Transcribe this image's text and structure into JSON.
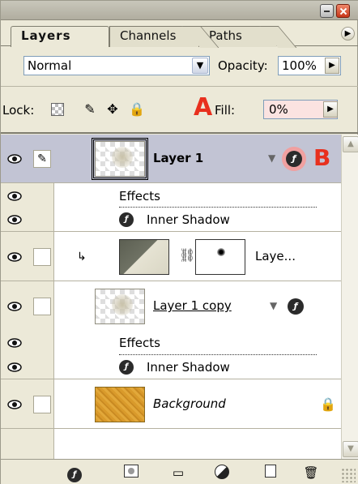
{
  "tabs": [
    {
      "label": "Layers",
      "active": true
    },
    {
      "label": "Channels",
      "active": false
    },
    {
      "label": "Paths",
      "active": false
    }
  ],
  "blend": {
    "mode": "Normal",
    "opacity_label": "Opacity:",
    "opacity_value": "100%"
  },
  "lock": {
    "label": "Lock:",
    "fill_label": "Fill:",
    "fill_value": "0%"
  },
  "annotations": {
    "a": "A",
    "b": "B"
  },
  "layers": [
    {
      "name": "Layer 1",
      "selected": true,
      "effects_label": "Effects",
      "effect_name": "Inner Shadow"
    },
    {
      "name": "Laye..."
    },
    {
      "name": "Layer 1 copy",
      "effects_label": "Effects",
      "effect_name": "Inner Shadow"
    },
    {
      "name": "Background"
    }
  ],
  "icons": {
    "eye": "eye-icon",
    "brush": "brush-icon",
    "fx": "fx-icon",
    "lock": "lock-icon",
    "chain": "chain-link-icon",
    "trash": "trash-icon"
  },
  "colors": {
    "annotation": "#e8301e",
    "selected_row": "#c2c4d4",
    "fill_highlight": "#fbe3e1"
  }
}
